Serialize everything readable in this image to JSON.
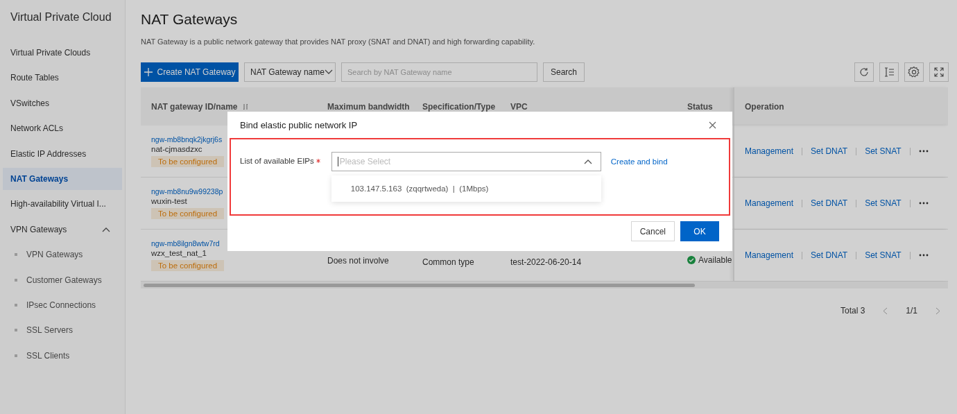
{
  "sidebar": {
    "title": "Virtual Private Cloud",
    "items": [
      {
        "label": "Virtual Private Clouds",
        "selected": false
      },
      {
        "label": "Route Tables",
        "selected": false
      },
      {
        "label": "VSwitches",
        "selected": false
      },
      {
        "label": "Network ACLs",
        "selected": false
      },
      {
        "label": "Elastic IP Addresses",
        "selected": false
      },
      {
        "label": "NAT Gateways",
        "selected": true
      },
      {
        "label": "High-availability Virtual I...",
        "selected": false
      },
      {
        "label": "VPN Gateways",
        "selected": false,
        "expanded": true,
        "children": [
          {
            "label": "VPN Gateways",
            "selected": false
          },
          {
            "label": "Customer Gateways",
            "selected": false
          },
          {
            "label": "IPsec Connections",
            "selected": false
          },
          {
            "label": "SSL Servers",
            "selected": false
          },
          {
            "label": "SSL Clients",
            "selected": false
          }
        ]
      }
    ]
  },
  "page": {
    "title": "NAT Gateways",
    "description": "NAT Gateway is a public network gateway that provides NAT proxy (SNAT and DNAT) and high forwarding capability."
  },
  "toolbar": {
    "create_button": "Create NAT Gateway",
    "filter_select": "NAT Gateway name",
    "search_placeholder": "Search by NAT Gateway name",
    "search_button": "Search"
  },
  "table": {
    "columns": [
      {
        "label": "NAT gateway ID/name",
        "sortable": true
      },
      {
        "label": "Maximum bandwidth",
        "sortable": false
      },
      {
        "label": "Specification/Type",
        "sortable": false
      },
      {
        "label": "VPC",
        "sortable": false
      },
      {
        "label": "Status",
        "sortable": false
      },
      {
        "label": "Operation",
        "sortable": false
      }
    ],
    "rows": [
      {
        "id": "ngw-mb8bnqk2jkgrj6s",
        "name": "nat-cjmasdzxc",
        "tag": "To be configured",
        "operations": [
          "Management",
          "Set DNAT",
          "Set SNAT"
        ]
      },
      {
        "id": "ngw-mb8nu9w99238p",
        "name": "wuxin-test",
        "tag": "To be configured",
        "operations": [
          "Management",
          "Set DNAT",
          "Set SNAT"
        ]
      },
      {
        "id": "ngw-mb8ilgn8wtw7rd",
        "name": "wzx_test_nat_1",
        "tag": "To be configured",
        "bandwidth": "Does not involve",
        "spec": "Common type",
        "vpc": "test-2022-06-20-14",
        "status": "Available",
        "operations": [
          "Management",
          "Set DNAT",
          "Set SNAT"
        ]
      }
    ]
  },
  "pagination": {
    "total": "Total 3",
    "page": "1/1"
  },
  "dialog": {
    "title": "Bind elastic public network IP",
    "highlighted": true,
    "field_label": "List of available EIPs",
    "required": true,
    "select": {
      "placeholder": "Please Select",
      "open": true,
      "options": [
        "103.147.5.163  (zqqrtweda)  |  (1Mbps)"
      ]
    },
    "link": "Create and bind",
    "buttons": [
      {
        "label": "Cancel",
        "kind": "secondary"
      },
      {
        "label": "OK",
        "kind": "primary"
      }
    ]
  }
}
